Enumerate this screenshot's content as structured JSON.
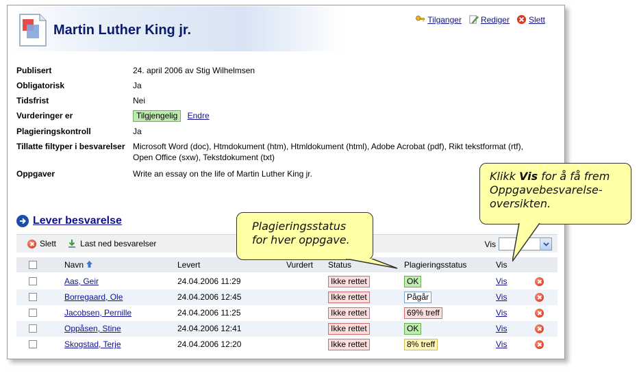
{
  "page": {
    "title": "Martin Luther King jr.",
    "actions": {
      "access": "Tilganger",
      "edit": "Rediger",
      "delete": "Slett"
    }
  },
  "properties": [
    {
      "label": "Publisert",
      "value": "24. april 2006 av Stig Wilhelmsen"
    },
    {
      "label": "Obligatorisk",
      "value": "Ja"
    },
    {
      "label": "Tidsfrist",
      "value": "Nei"
    },
    {
      "label": "Vurderinger er",
      "value": "Tilgjengelig",
      "link": "Endre"
    },
    {
      "label": "Plagieringskontroll",
      "value": "Ja"
    },
    {
      "label": "Tillatte filtyper i besvarelser",
      "value": "Microsoft Word (doc), Htmdokument (htm), Htmldokument (html), Adobe Acrobat (pdf), Rikt tekstformat (rtf), Open Office (sxw), Tekstdokument (txt)"
    },
    {
      "label": "Oppgaver",
      "value": "Write an essay on the life of Martin Luther King jr."
    }
  ],
  "submit_label": "Lever besvarelse",
  "toolbar": {
    "delete": "Slett",
    "download": "Last ned besvarelser",
    "show_label": "Vis"
  },
  "table": {
    "columns": {
      "name": "Navn",
      "delivered": "Levert",
      "assessed": "Vurdert",
      "status": "Status",
      "plagiarism": "Plagieringsstatus",
      "show": "Vis"
    },
    "rows": [
      {
        "name": "Aas, Geir",
        "delivered": "24.04.2006 11:29",
        "status": "Ikke rettet",
        "plagiarism": "OK",
        "plag_type": "green",
        "show": "Vis"
      },
      {
        "name": "Borregaard, Ole",
        "delivered": "24.04.2006 12:45",
        "status": "Ikke rettet",
        "plagiarism": "Pågår",
        "plag_type": "blue",
        "show": "Vis"
      },
      {
        "name": "Jacobsen, Pernille",
        "delivered": "24.04.2006 11:25",
        "status": "Ikke rettet",
        "plagiarism": "69% treff",
        "plag_type": "red",
        "show": "Vis"
      },
      {
        "name": "Oppåsen, Stine",
        "delivered": "24.04.2006 12:41",
        "status": "Ikke rettet",
        "plagiarism": "OK",
        "plag_type": "green",
        "show": "Vis"
      },
      {
        "name": "Skogstad, Terje",
        "delivered": "24.04.2006 12:20",
        "status": "Ikke rettet",
        "plagiarism": "8% treff",
        "plag_type": "yellow",
        "show": "Vis"
      }
    ]
  },
  "callouts": {
    "plagiarism_line1": "Plagieringsstatus",
    "plagiarism_line2": "for hver oppgave.",
    "vis_pre": "Klikk ",
    "vis_bold": "Vis",
    "vis_post": " for å få frem",
    "vis_line2": "Oppgavebesvarelse-",
    "vis_line3": "oversikten."
  }
}
